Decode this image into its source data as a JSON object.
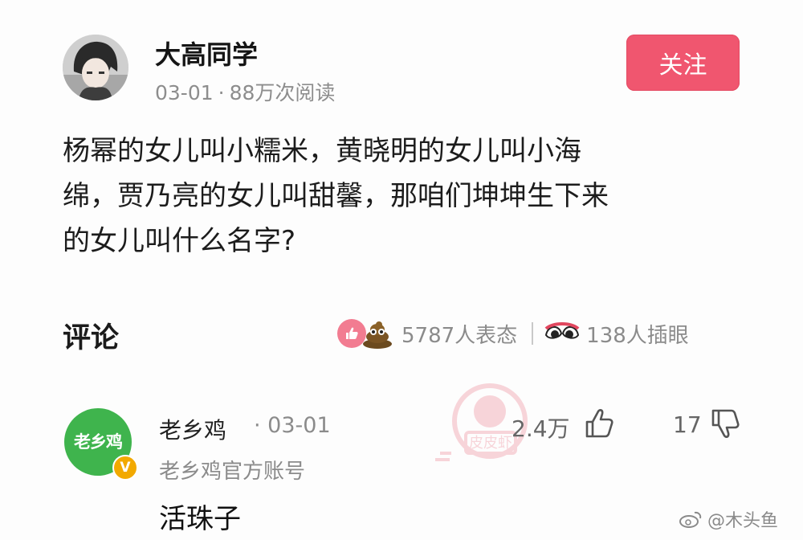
{
  "author": {
    "name": "大高同学",
    "date": "03-01",
    "dot": "·",
    "reads": "88万次阅读",
    "follow_label": "关注"
  },
  "post": {
    "lines": [
      "杨幂的女儿叫小糯米，黄晓明的女儿叫小海",
      "绵，贾乃亮的女儿叫甜馨，那咱们坤坤生下来",
      "的女儿叫什么名字?"
    ]
  },
  "comments_section": {
    "title": "评论",
    "reactions": "5787人表态",
    "eyes": "138人插眼"
  },
  "comment": {
    "avatar_text": "老乡鸡",
    "verified_mark": "V",
    "username": "老乡鸡",
    "date": "· 03-01",
    "subtitle": "老乡鸡官方账号",
    "body": "活珠子",
    "likes": "2.4万",
    "dislikes": "17"
  },
  "watermarks": {
    "stamp": "皮皮虾",
    "weibo": "@木头鱼"
  },
  "colors": {
    "follow_button": "#f0566f",
    "like_badge": "#f27c91",
    "avatar_green": "#3fb44d",
    "verified": "#f2a900"
  },
  "icons": [
    "user-avatar",
    "like-icon",
    "poop-icon",
    "eyes-icon",
    "verified-icon",
    "thumbs-up-icon",
    "thumbs-down-icon",
    "weibo-icon"
  ]
}
